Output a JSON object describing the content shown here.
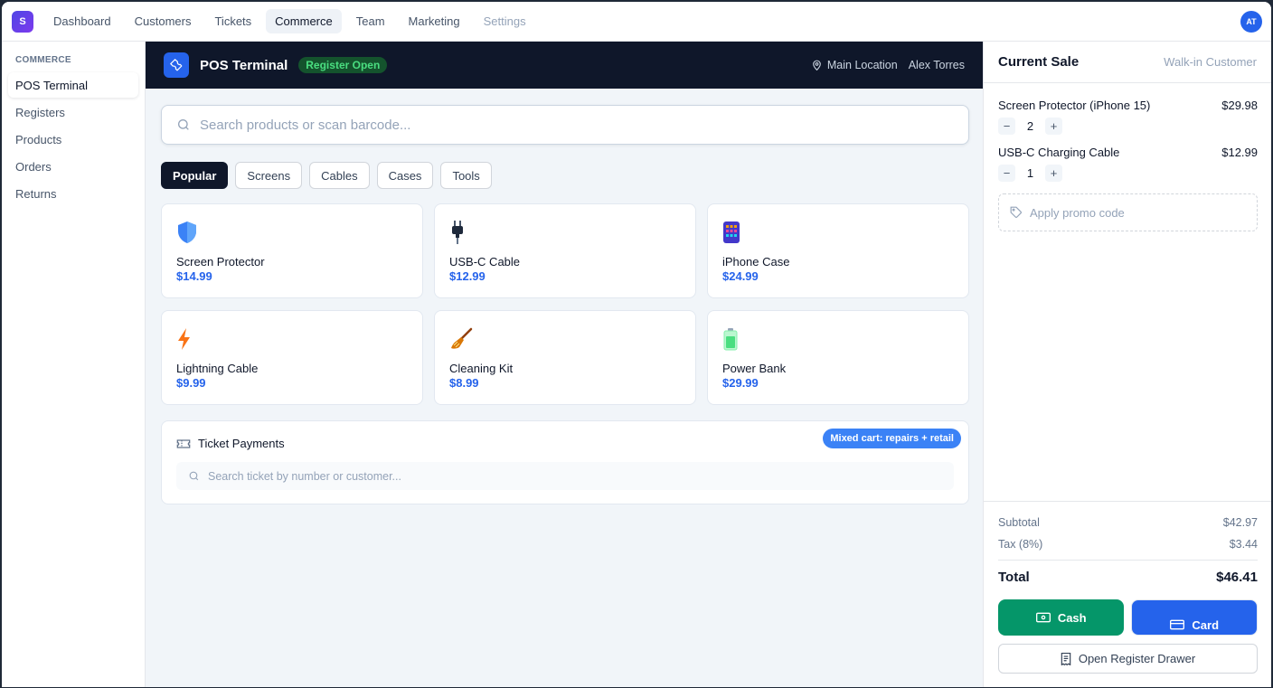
{
  "nav": {
    "logo_letter": "S",
    "tabs": [
      "Dashboard",
      "Customers",
      "Tickets",
      "Commerce",
      "Team",
      "Marketing",
      "Settings"
    ],
    "active_tab": "Commerce",
    "avatar_initials": "AT"
  },
  "sidebar": {
    "heading": "COMMERCE",
    "items": [
      "POS Terminal",
      "Registers",
      "Products",
      "Orders",
      "Returns"
    ],
    "active": "POS Terminal"
  },
  "pos": {
    "title": "POS Terminal",
    "status": "Register Open",
    "location": "Main Location",
    "user": "Alex Torres",
    "search_placeholder": "Search products or scan barcode...",
    "categories": [
      "Popular",
      "Screens",
      "Cables",
      "Cases",
      "Tools"
    ],
    "active_category": "Popular",
    "products": [
      {
        "name": "Screen Protector",
        "price": "$14.99",
        "icon": "shield-icon"
      },
      {
        "name": "USB-C Cable",
        "price": "$12.99",
        "icon": "plug-icon"
      },
      {
        "name": "iPhone Case",
        "price": "$24.99",
        "icon": "phone-case-icon"
      },
      {
        "name": "Lightning Cable",
        "price": "$9.99",
        "icon": "lightning-icon"
      },
      {
        "name": "Cleaning Kit",
        "price": "$8.99",
        "icon": "broom-icon"
      },
      {
        "name": "Power Bank",
        "price": "$29.99",
        "icon": "battery-icon"
      }
    ],
    "tickets": {
      "title": "Ticket Payments",
      "badge": "Mixed cart: repairs + retail",
      "search_placeholder": "Search ticket by number or customer..."
    }
  },
  "sale": {
    "title": "Current Sale",
    "customer": "Walk-in Customer",
    "lines": [
      {
        "name": "Screen Protector (iPhone 15)",
        "amount": "$29.98",
        "qty": "2"
      },
      {
        "name": "USB-C Charging Cable",
        "amount": "$12.99",
        "qty": "1"
      }
    ],
    "promo_placeholder": "Apply promo code",
    "subtotal_label": "Subtotal",
    "subtotal": "$42.97",
    "tax_label": "Tax (8%)",
    "tax": "$3.44",
    "total_label": "Total",
    "total": "$46.41",
    "cash_label": "Cash",
    "card_label": "Card",
    "drawer_label": "Open Register Drawer"
  },
  "colors": {
    "accent": "#2563eb",
    "success": "#059669",
    "dark": "#0f172a"
  }
}
